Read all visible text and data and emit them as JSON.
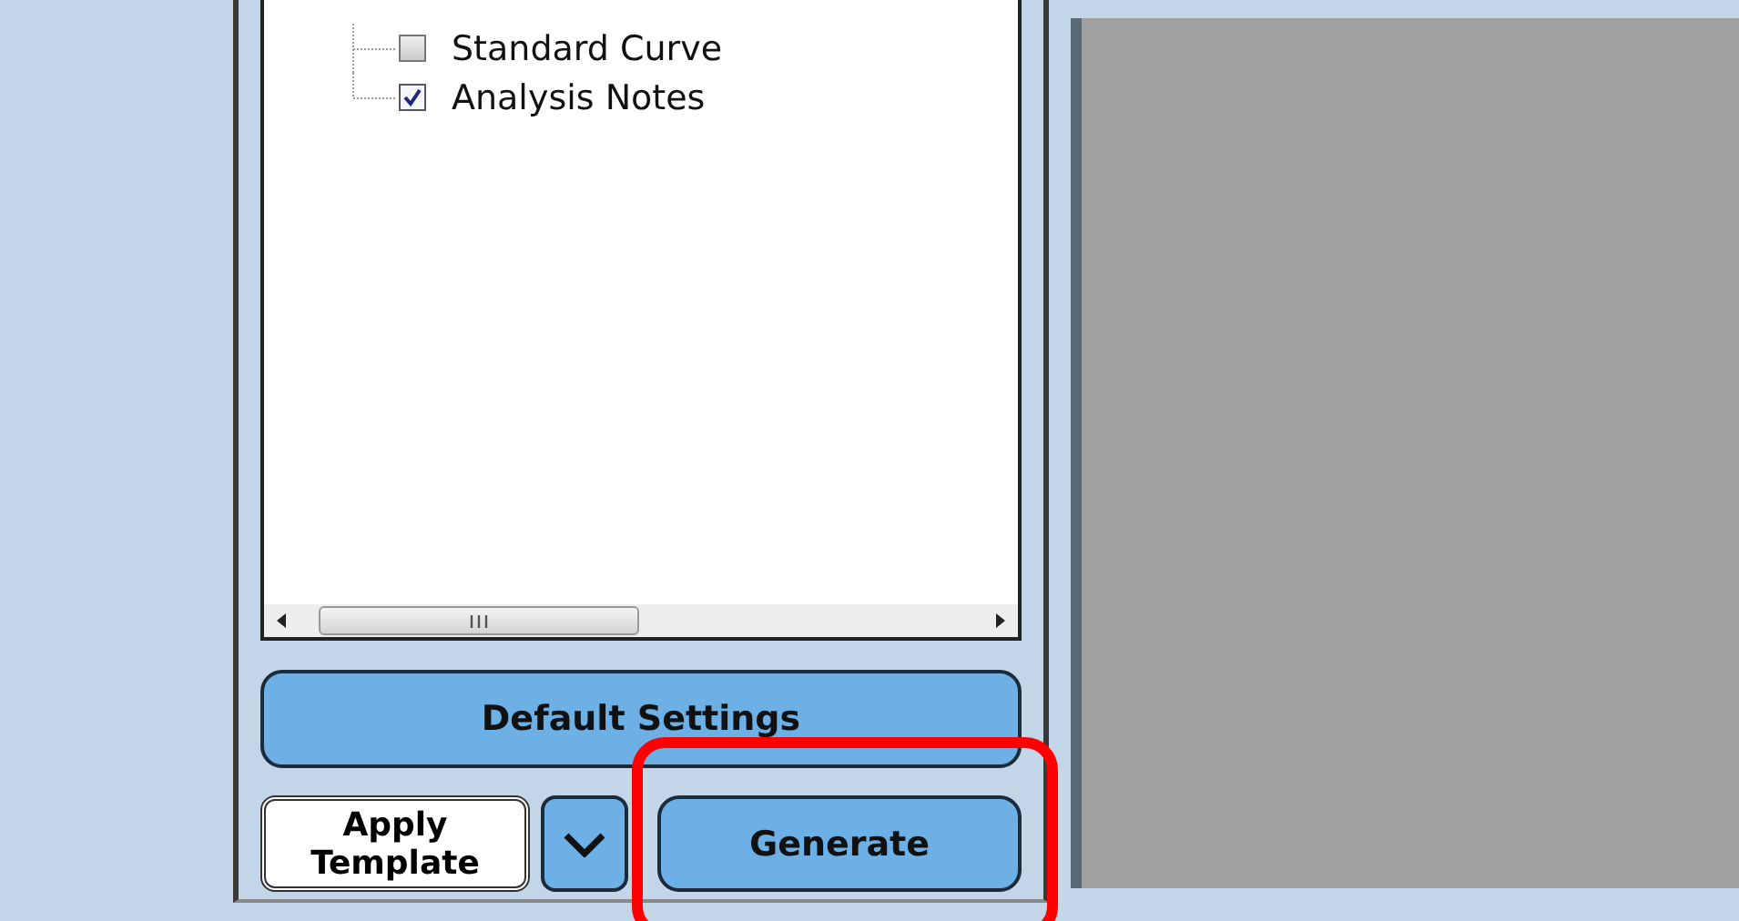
{
  "tree": {
    "items": [
      {
        "label": "Standard Curve",
        "checked": false
      },
      {
        "label": "Analysis Notes",
        "checked": true
      }
    ]
  },
  "buttons": {
    "default": "Default Settings",
    "apply": "Apply Template",
    "generate": {
      "label": "Generate",
      "highlighted": true
    }
  }
}
